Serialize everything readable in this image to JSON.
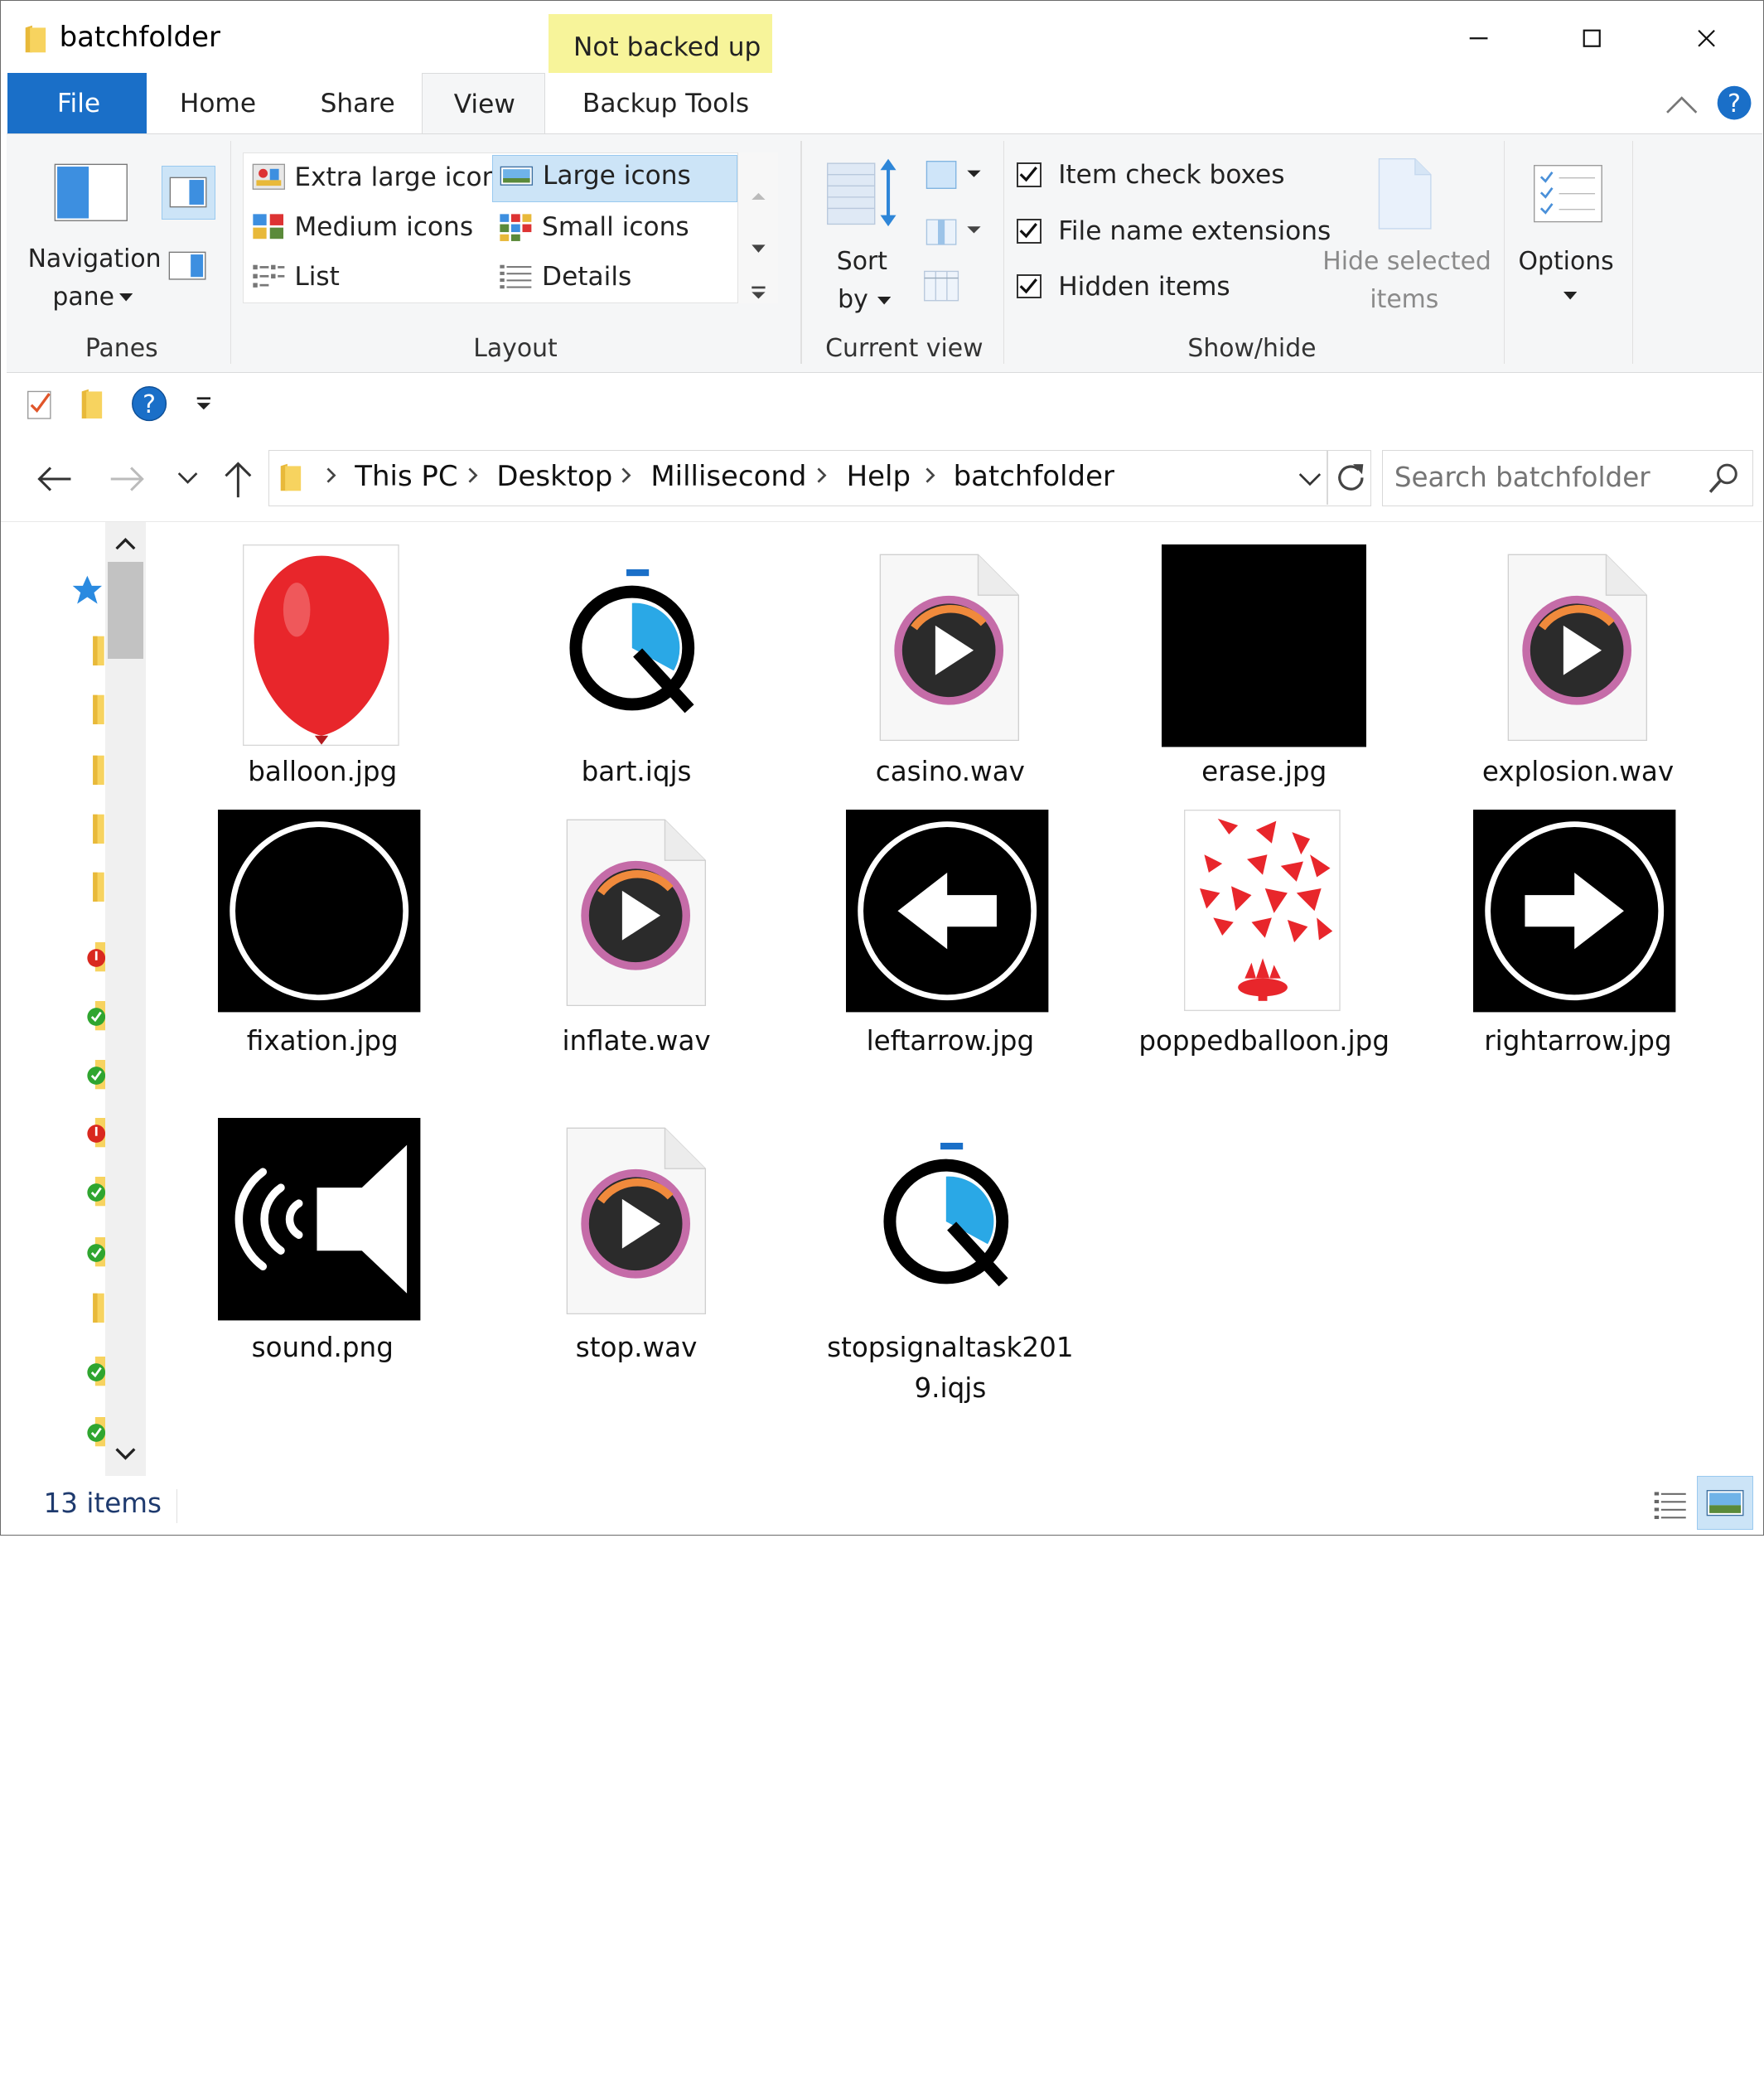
{
  "window": {
    "title": "batchfolder",
    "context_tab": "Not backed up"
  },
  "tabs": {
    "file": "File",
    "home": "Home",
    "share": "Share",
    "view": "View",
    "backup_tools": "Backup Tools"
  },
  "ribbon": {
    "panes": {
      "label": "Panes",
      "navigation_pane_1": "Navigation",
      "navigation_pane_2": "pane"
    },
    "layout": {
      "label": "Layout",
      "extra_large": "Extra large icons",
      "large": "Large icons",
      "medium": "Medium icons",
      "small": "Small icons",
      "list": "List",
      "details": "Details",
      "selected": "Large icons"
    },
    "current_view": {
      "label": "Current view",
      "sort_1": "Sort",
      "sort_2": "by"
    },
    "show_hide": {
      "label": "Show/hide",
      "item_check_boxes": "Item check boxes",
      "file_name_extensions": "File name extensions",
      "hidden_items": "Hidden items",
      "item_check_boxes_checked": true,
      "file_name_extensions_checked": true,
      "hidden_items_checked": true,
      "hide_selected_1": "Hide selected",
      "hide_selected_2": "items"
    },
    "options": {
      "label": "Options"
    }
  },
  "address": {
    "crumbs": [
      "This PC",
      "Desktop",
      "Millisecond",
      "Help",
      "batchfolder"
    ],
    "search_placeholder": "Search batchfolder"
  },
  "files": [
    {
      "name": "balloon.jpg",
      "icon": "balloon-thumbnail"
    },
    {
      "name": "bart.iqjs",
      "icon": "inquisit-stopwatch-icon"
    },
    {
      "name": "casino.wav",
      "icon": "audio-file-icon"
    },
    {
      "name": "erase.jpg",
      "icon": "black-image-thumbnail"
    },
    {
      "name": "explosion.wav",
      "icon": "audio-file-icon"
    },
    {
      "name": "fixation.jpg",
      "icon": "circle-thumbnail"
    },
    {
      "name": "inflate.wav",
      "icon": "audio-file-icon"
    },
    {
      "name": "leftarrow.jpg",
      "icon": "left-arrow-thumbnail"
    },
    {
      "name": "poppedballoon.jpg",
      "icon": "popped-balloon-thumbnail"
    },
    {
      "name": "rightarrow.jpg",
      "icon": "right-arrow-thumbnail"
    },
    {
      "name": "sound.png",
      "icon": "speaker-thumbnail"
    },
    {
      "name": "stop.wav",
      "icon": "audio-file-icon"
    },
    {
      "name": "stopsignaltask2019.iqjs",
      "icon": "inquisit-stopwatch-icon"
    }
  ],
  "status": {
    "count": "13 items"
  },
  "colors": {
    "file_tab": "#1a6fc8",
    "context_tab": "#f7f49a",
    "selection": "#cce4f7",
    "help": "#1a6fc8"
  }
}
